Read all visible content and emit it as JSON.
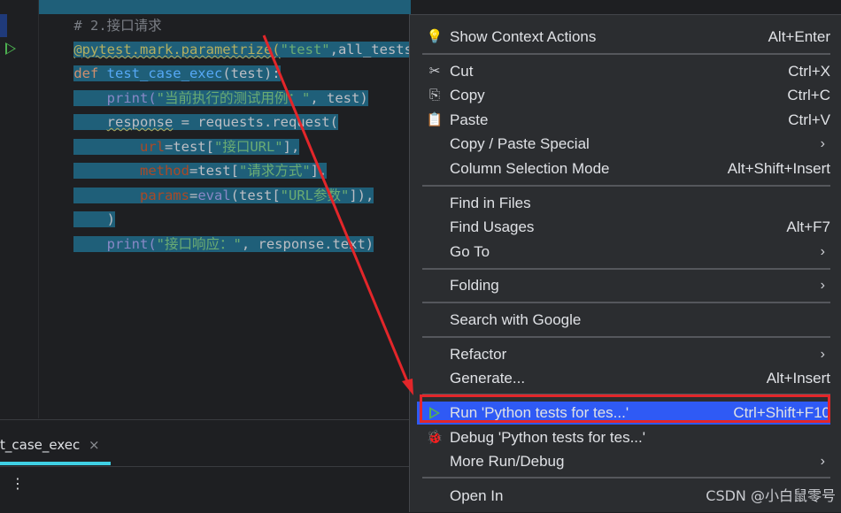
{
  "editor": {
    "lines": [
      {
        "text": "# 2.接口请求"
      },
      {
        "decorator": "@pytest.mark.parametrize(",
        "arg1": "\"test\"",
        "comma": ",all_tests)"
      },
      {
        "kw": "def ",
        "fn": "test_case_exec",
        "rest": "(test):"
      },
      {
        "print": "print(",
        "str": "\"当前执行的测试用例：\"",
        "rest": ", test)"
      },
      {
        "var": "response",
        "rest": " = requests.request("
      },
      {
        "param": "url",
        "eq": "=test[",
        "str": "\"接口URL\"",
        "rest": "],"
      },
      {
        "param": "method",
        "eq": "=test[",
        "str": "\"请求方式\"",
        "rest": "],"
      },
      {
        "param": "params",
        "eq": "=",
        "bi": "eval",
        "mid": "(test[",
        "str": "\"URL参数\"",
        "rest": "]),"
      },
      {
        "text": ")"
      },
      {
        "print": "print(",
        "str": "\"接口响应：\"",
        "rest": ", response.text)"
      }
    ]
  },
  "tool_window": {
    "tab_label": "t_case_exec",
    "close_glyph": "×",
    "menu_glyph": "⋮"
  },
  "context_menu": {
    "items": [
      {
        "icon": "lightbulb-icon",
        "icon_glyph": "💡",
        "label": "Show Context Actions",
        "shortcut": "Alt+Enter"
      },
      {
        "icon": "scissors-icon",
        "icon_glyph": "✂",
        "label": "Cut",
        "shortcut": "Ctrl+X"
      },
      {
        "icon": "copy-icon",
        "icon_glyph": "⎘",
        "label": "Copy",
        "shortcut": "Ctrl+C"
      },
      {
        "icon": "paste-icon",
        "icon_glyph": "📋",
        "label": "Paste",
        "shortcut": "Ctrl+V"
      },
      {
        "label": "Copy / Paste Special",
        "arrow": "›"
      },
      {
        "label": "Column Selection Mode",
        "shortcut": "Alt+Shift+Insert"
      },
      {
        "label": "Find in Files"
      },
      {
        "label": "Find Usages",
        "shortcut": "Alt+F7"
      },
      {
        "label": "Go To",
        "arrow": "›"
      },
      {
        "label": "Folding",
        "arrow": "›"
      },
      {
        "label": "Search with Google"
      },
      {
        "label": "Refactor",
        "arrow": "›"
      },
      {
        "label": "Generate...",
        "shortcut": "Alt+Insert"
      },
      {
        "icon": "run-icon",
        "label": "Run 'Python tests for tes...'",
        "shortcut": "Ctrl+Shift+F10"
      },
      {
        "icon": "debug-bug-icon",
        "icon_glyph": "🐞",
        "label": "Debug 'Python tests for tes...'"
      },
      {
        "label": "More Run/Debug",
        "arrow": "›"
      },
      {
        "label": "Open In"
      }
    ]
  },
  "watermark": "CSDN @小白鼠零号",
  "colors": {
    "menu_bg": "#2b2d30",
    "selection": "#1f5f79",
    "highlight": "#2f5af5",
    "annotation_red": "#e3262a"
  }
}
